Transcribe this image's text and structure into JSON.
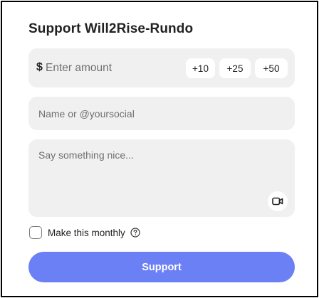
{
  "title": "Support Will2Rise-Rundo",
  "amount": {
    "currency_symbol": "$",
    "placeholder": "Enter amount",
    "presets": [
      "+10",
      "+25",
      "+50"
    ]
  },
  "name_field": {
    "placeholder": "Name or @yoursocial"
  },
  "message_field": {
    "placeholder": "Say something nice...",
    "attach_icon": "video-camera-icon"
  },
  "monthly": {
    "label": "Make this monthly",
    "checked": false,
    "help_icon": "question-circle-icon"
  },
  "submit": {
    "label": "Support"
  },
  "colors": {
    "accent": "#6c80f5",
    "field_bg": "#f0f0f0",
    "text": "#222222",
    "placeholder": "#6f6f6f"
  }
}
